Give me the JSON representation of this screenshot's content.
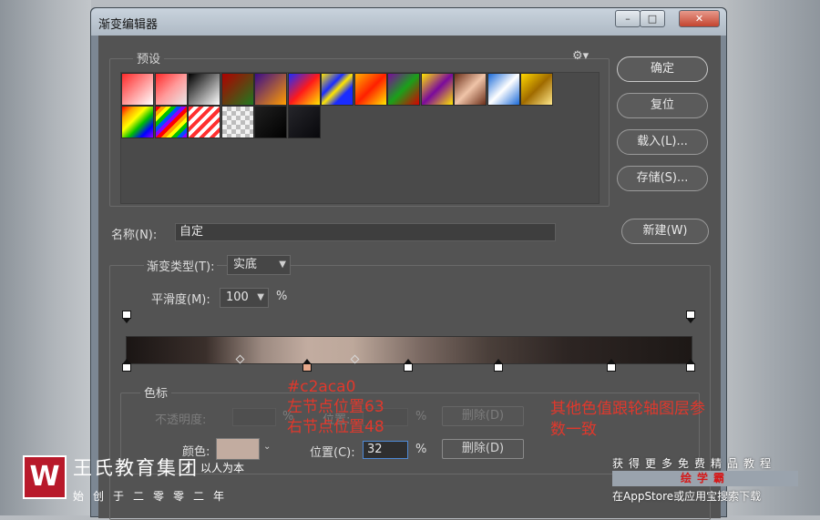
{
  "window": {
    "title": "渐变编辑器",
    "min_label": "–",
    "max_label": "□",
    "close_label": "✕"
  },
  "presets": {
    "label": "预设",
    "gear_icon": "⚙▾",
    "swatches": [
      {
        "bg": "linear-gradient(135deg,#ff2a2a,#ffffff)"
      },
      {
        "bg": "linear-gradient(135deg,#ff2a2a 0%,#ff9a9a 50%,#e8e8e8 100%)"
      },
      {
        "bg": "linear-gradient(135deg,#000000,#ffffff)"
      },
      {
        "bg": "linear-gradient(135deg,#b00000,#1f7a1f)"
      },
      {
        "bg": "linear-gradient(135deg,#3a0c8a,#ff9c00)"
      },
      {
        "bg": "linear-gradient(135deg,#1a2cff,#ff1a1a,#ffe600)"
      },
      {
        "bg": "linear-gradient(135deg,#ffe600 0%,#1a2cff 35%,#ffe600 50%,#1a2cff 70%)"
      },
      {
        "bg": "linear-gradient(135deg,#ffb000,#ff2000,#ffe600)"
      },
      {
        "bg": "linear-gradient(135deg,#7a0a9c,#1aa01a,#d80000)"
      },
      {
        "bg": "linear-gradient(135deg,#ffe600,#7a0a9c,#ffe600)"
      },
      {
        "bg": "linear-gradient(135deg,#6b2f1a,#f0c4a8,#6b2f1a)"
      },
      {
        "bg": "linear-gradient(135deg,#1a6ad8,#ffffff,#1a6ad8)"
      },
      {
        "bg": "linear-gradient(135deg,#ffd700,#a06b00,#ffe88a)"
      },
      {
        "bg": "linear-gradient(135deg,#ff0000,#ffa500,#ffff00,#00c000,#0000ff,#8a00ff)"
      },
      {
        "bg": "repeating-linear-gradient(135deg,#ff0000 0 4px,#ffa500 4px 8px,#ffff00 8px 12px,#00c000 12px 16px,#0050ff 16px 20px,#8a00ff 20px 24px)"
      },
      {
        "bg": "repeating-linear-gradient(135deg,#ff3030 0 4px,#ffffff 4px 8px)"
      },
      {
        "bg": "repeating-conic-gradient(#bdbdbd 0 25%,#f2f2f2 0 50%) 0 0/10px 10px"
      },
      {
        "bg": "linear-gradient(135deg,#202020,#000000)"
      },
      {
        "bg": "linear-gradient(135deg,#25252a,#08080c)"
      }
    ]
  },
  "buttons": {
    "ok": "确定",
    "reset": "复位",
    "load": "载入(L)...",
    "save": "存储(S)...",
    "new": "新建(W)"
  },
  "name": {
    "label": "名称(N):",
    "value": "自定"
  },
  "gradient": {
    "type_label": "渐变类型(T):",
    "type_value": "实底",
    "smooth_label": "平滑度(M):",
    "smooth_value": "100",
    "smooth_unit": "%"
  },
  "color_stops_panel": {
    "legend": "色标",
    "opacity_label": "不透明度:",
    "opacity_unit": "%",
    "opacity_position_label": "位置:",
    "opacity_position_unit": "%",
    "delete_disabled": "删除(D)",
    "color_label": "颜色:",
    "color_value": "#c2aca0",
    "position_label": "位置(C):",
    "position_value": "32",
    "position_unit": "%",
    "delete": "删除(D)"
  },
  "annotations": {
    "hex": "#c2aca0",
    "left_node": "左节点位置63",
    "right_node": "右节点位置48",
    "note_line1": "其他色值跟轮轴图层参",
    "note_line2": "数一致"
  },
  "watermark": {
    "logo": "W",
    "brand": "王氏教育集团",
    "slogan": "以人为本",
    "since": "始创于二零零二年",
    "promo1": "获得更多免费精品教程",
    "promo2": "绘学霸",
    "promo3": "在AppStore或应用宝搜索下载"
  }
}
